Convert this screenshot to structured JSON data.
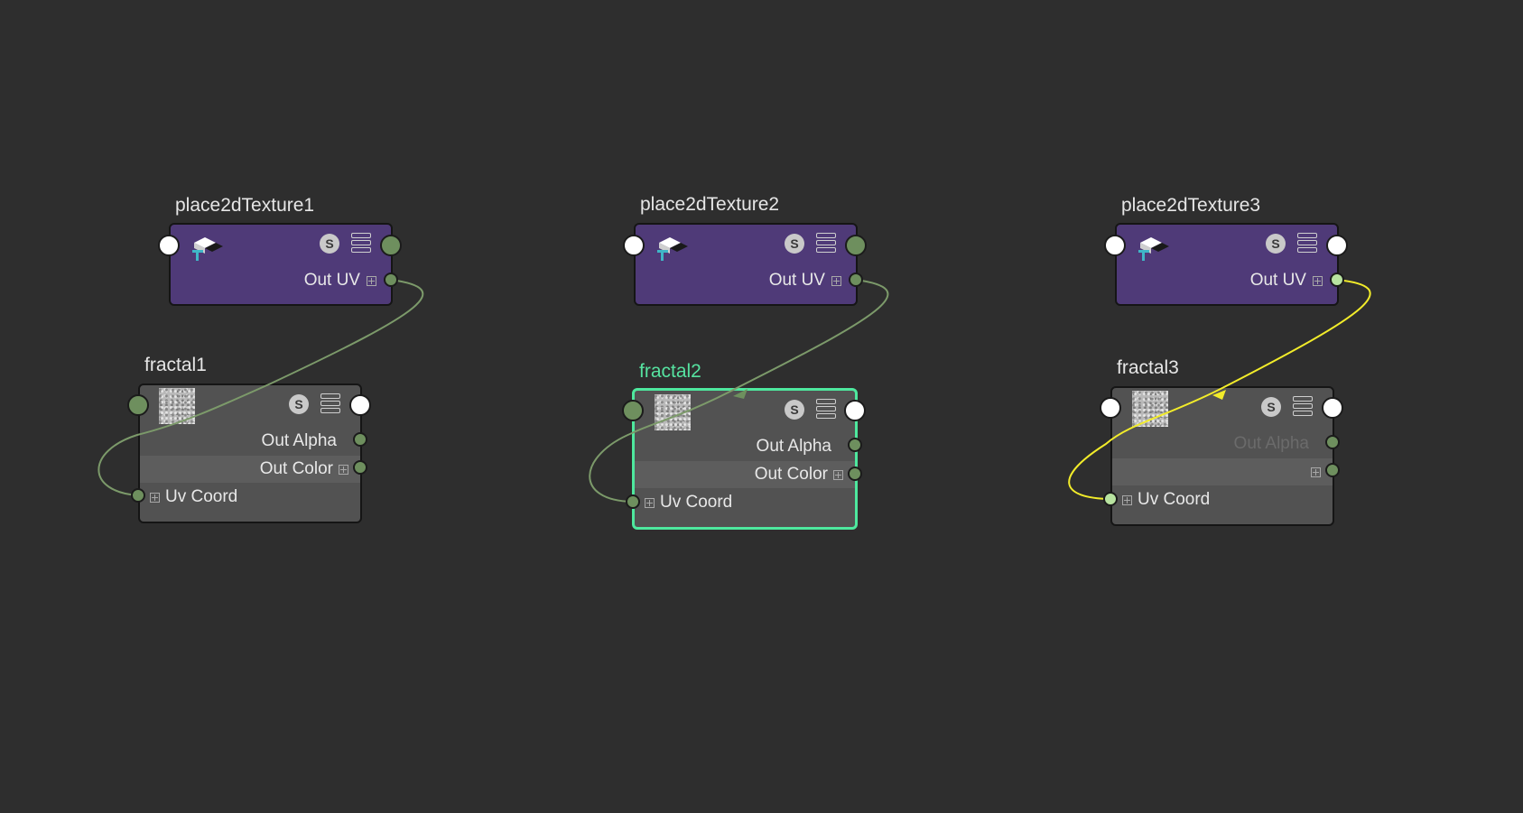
{
  "colors": {
    "background": "#2e2e2e",
    "place_node": "#4f3a78",
    "texture_node": "#525252",
    "selected_outline": "#4ee89e",
    "wire_default": "#7c9a6a",
    "wire_highlight": "#f2ec2a"
  },
  "icons": {
    "place_icon": "place2d-texture-icon",
    "thumb": "fractal-noise-thumbnail",
    "swatch_button": "s-swatch-icon",
    "attr_button": "attribute-list-icon",
    "expand": "plus-box-icon"
  },
  "nodes": {
    "place1": {
      "title": "place2dTexture1",
      "port_label": "Out UV"
    },
    "place2": {
      "title": "place2dTexture2",
      "port_label": "Out UV"
    },
    "place3": {
      "title": "place2dTexture3",
      "port_label": "Out UV"
    },
    "fractal1": {
      "title": "fractal1",
      "out_alpha": "Out Alpha",
      "out_color": "Out Color",
      "uv_coord": "Uv Coord"
    },
    "fractal2": {
      "title": "fractal2",
      "out_alpha": "Out Alpha",
      "out_color": "Out Color",
      "uv_coord": "Uv Coord",
      "selected": true
    },
    "fractal3": {
      "title": "fractal3",
      "out_alpha": "Out Alpha",
      "uv_coord": "Uv Coord"
    }
  },
  "swatch_letter": "S"
}
